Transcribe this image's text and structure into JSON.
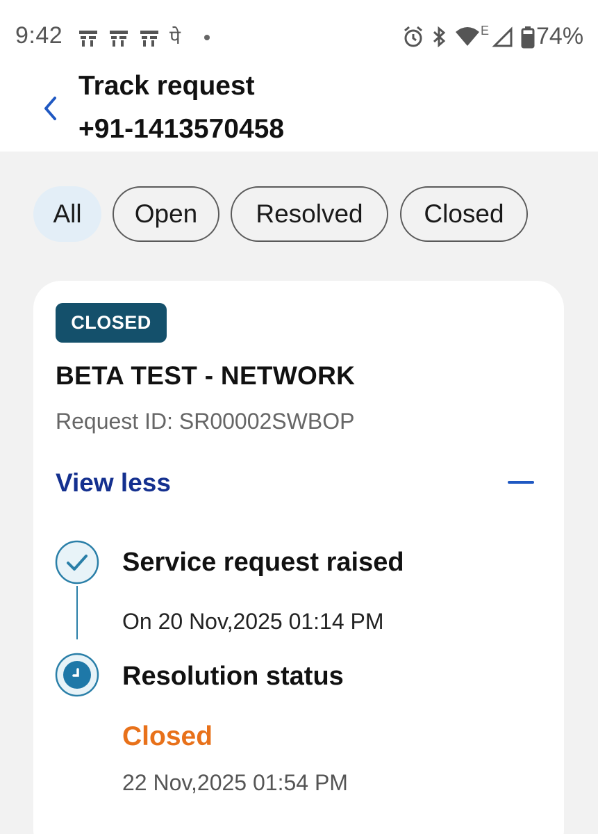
{
  "status_bar": {
    "time": "9:42",
    "notification_icons": [
      "app-notification-icon",
      "app-notification-icon",
      "app-notification-icon",
      "phonepe-icon"
    ],
    "phonepe_glyph": "पे",
    "network_label": "E",
    "battery": "74%"
  },
  "header": {
    "title": "Track request",
    "subtitle": "+91-1413570458"
  },
  "filters": [
    {
      "label": "All",
      "active": true
    },
    {
      "label": "Open",
      "active": false
    },
    {
      "label": "Resolved",
      "active": false
    },
    {
      "label": "Closed",
      "active": false
    }
  ],
  "request": {
    "status_badge": "CLOSED",
    "title": "BETA TEST - NETWORK",
    "request_id": "Request ID: SR00002SWBOP",
    "toggle_label": "View less",
    "timeline": [
      {
        "title": "Service request raised",
        "date": "On 20 Nov,2025 01:14 PM",
        "state": "done"
      },
      {
        "title": "Resolution status",
        "status": "Closed",
        "date": "22 Nov,2025 01:54 PM",
        "state": "current"
      }
    ]
  },
  "colors": {
    "badge": "#14506b",
    "link": "#14308f",
    "closed_status": "#e8711a",
    "chip_active_bg": "#e3eef7",
    "timeline": "#2a7fa8"
  }
}
